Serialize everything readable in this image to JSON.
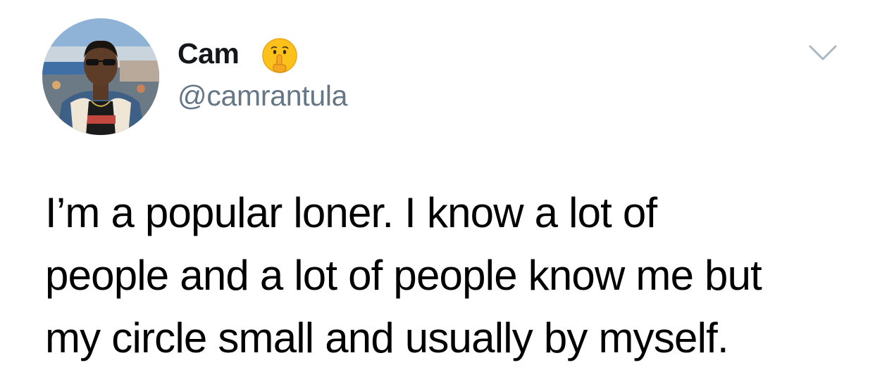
{
  "author": {
    "display_name": "Cam",
    "handle": "@camrantula",
    "emoji_icon": "shushing-face-icon"
  },
  "menu": {
    "caret_icon": "chevron-down-icon"
  },
  "tweet": {
    "lines": [
      "I’m a popular loner. I know a lot of",
      "people and a lot of people know me but",
      "my circle small and usually by myself."
    ]
  },
  "colors": {
    "name": "#14171a",
    "handle": "#657786",
    "text": "#000000",
    "caret": "#aab8c2",
    "background": "#ffffff"
  }
}
